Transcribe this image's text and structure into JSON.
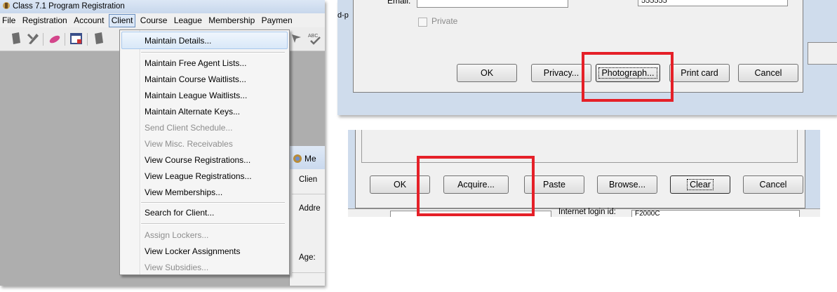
{
  "left": {
    "title": "Class 7.1 Program Registration",
    "menu": [
      {
        "label": "File",
        "active": false
      },
      {
        "label": "Registration",
        "active": false
      },
      {
        "label": "Account",
        "active": false
      },
      {
        "label": "Client",
        "active": true
      },
      {
        "label": "Course",
        "active": false
      },
      {
        "label": "League",
        "active": false
      },
      {
        "label": "Membership",
        "active": false
      },
      {
        "label": "Paymen",
        "active": false
      }
    ],
    "dropdown": {
      "items": [
        {
          "label": "Maintain Details...",
          "disabled": false
        },
        {
          "label": "Maintain Free Agent Lists...",
          "disabled": false
        },
        {
          "label": "Maintain Course Waitlists...",
          "disabled": false
        },
        {
          "label": "Maintain League Waitlists...",
          "disabled": false
        },
        {
          "label": "Maintain Alternate Keys...",
          "disabled": false
        },
        {
          "label": "Send Client Schedule...",
          "disabled": true
        },
        {
          "label": "View Misc. Receivables",
          "disabled": true
        },
        {
          "label": "View Course Registrations...",
          "disabled": false
        },
        {
          "label": "View League Registrations...",
          "disabled": false
        },
        {
          "label": "View Memberships...",
          "disabled": false
        },
        {
          "label": "Search for Client...",
          "disabled": false
        },
        {
          "label": "Assign Lockers...",
          "disabled": true
        },
        {
          "label": "View Locker Assignments",
          "disabled": false
        },
        {
          "label": "View Subsidies...",
          "disabled": true
        }
      ]
    },
    "member_window": {
      "title": "Me",
      "client_label": "Clien",
      "address_label": "Addre",
      "age_label": "Age:"
    }
  },
  "right_top": {
    "email_label": "Email:",
    "phone_value": "555555",
    "private_label": "Private",
    "side_text": "d-p",
    "buttons": [
      "OK",
      "Privacy...",
      "Photograph...",
      "Print card",
      "Cancel"
    ]
  },
  "right_bottom": {
    "buttons": [
      "OK",
      "Acquire...",
      "Paste",
      "Browse...",
      "Clear",
      "Cancel"
    ],
    "internet_label": "Internet login id:",
    "internet_value": "F2000C"
  },
  "colors": {
    "highlight": "#e52028",
    "menu_hover": "#dce8f7"
  }
}
